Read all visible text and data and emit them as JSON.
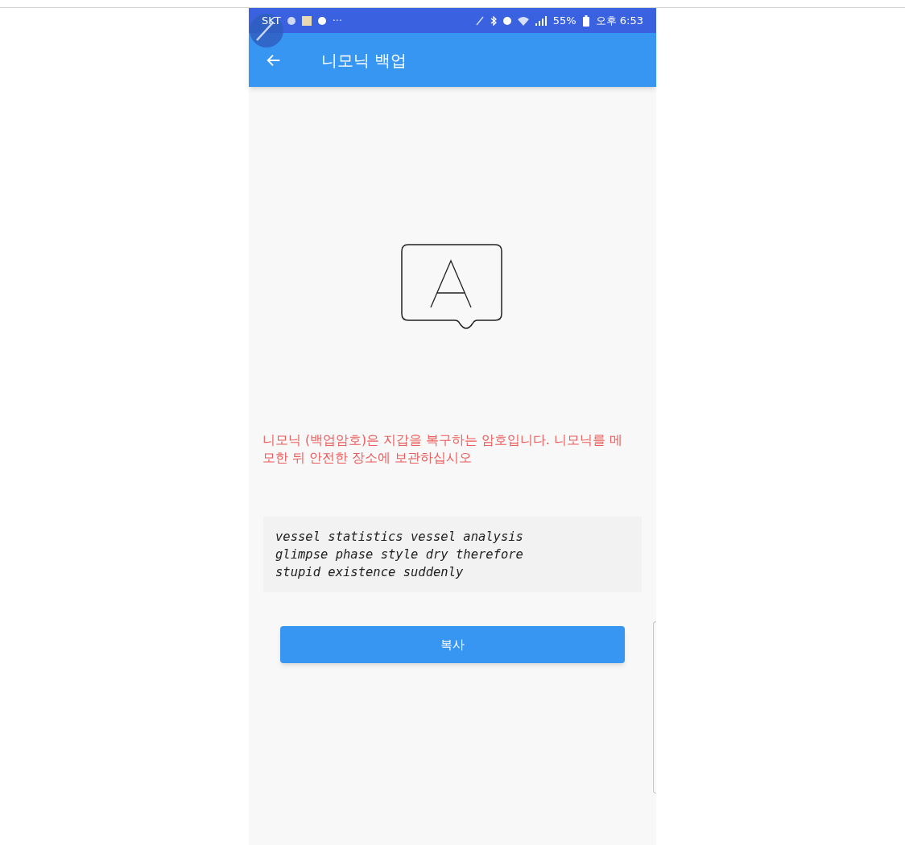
{
  "status_bar": {
    "carrier": "SKT",
    "dots": "···",
    "battery": "55%",
    "time": "오후 6:53"
  },
  "app_bar": {
    "title": "니모닉 백업"
  },
  "warning": "니모닉 (백업암호)은 지갑을 복구하는 암호입니다. 니모닉를 메모한 뒤 안전한 장소에 보관하십시오",
  "mnemonic": "vessel statistics vessel analysis glimpse phase style dry therefore stupid existence suddenly",
  "copy_button": "복사"
}
